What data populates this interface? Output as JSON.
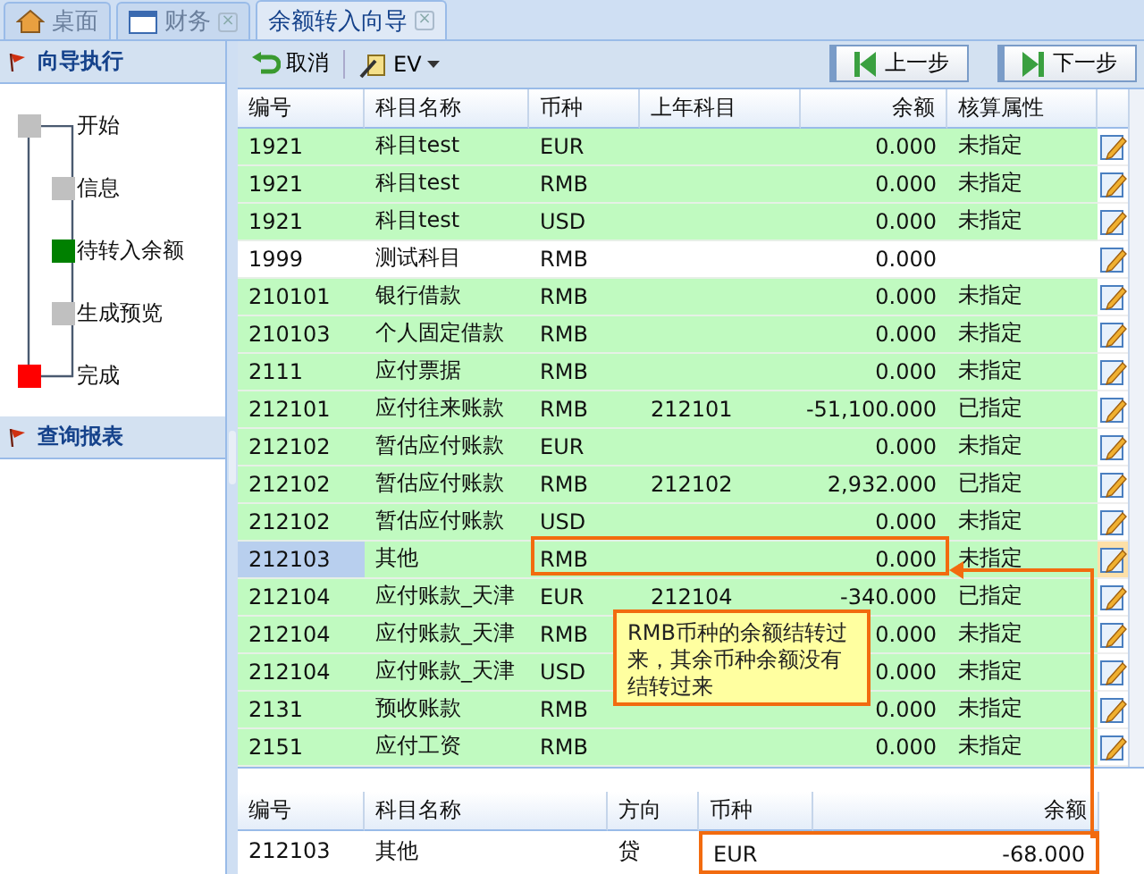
{
  "tabs": [
    {
      "label": "桌面",
      "selected": false
    },
    {
      "label": "财务",
      "close": "×",
      "selected": false
    },
    {
      "label": "余额转入向导",
      "close": "×",
      "selected": true
    }
  ],
  "sidebar": {
    "sections": [
      {
        "title": "向导执行",
        "expanded": true,
        "steps": [
          {
            "label": "开始",
            "kind": "endpoint",
            "color": "#c0c0c0"
          },
          {
            "label": "信息",
            "kind": "step",
            "color": "#c0c0c0"
          },
          {
            "label": "待转入余额",
            "kind": "step",
            "color": "#008000"
          },
          {
            "label": "生成预览",
            "kind": "step",
            "color": "#c0c0c0"
          },
          {
            "label": "完成",
            "kind": "endpoint",
            "color": "#ff0000"
          }
        ]
      },
      {
        "title": "查询报表",
        "expanded": false
      }
    ]
  },
  "toolbar": {
    "buttons": [
      {
        "label": "取消"
      },
      {
        "label": "EV"
      }
    ],
    "nav": [
      {
        "label": "上一步"
      },
      {
        "label": "下一步"
      }
    ]
  },
  "table": {
    "columns": [
      "编号",
      "科目名称",
      "币种",
      "上年科目",
      "余额",
      "核算属性"
    ],
    "rows": [
      {
        "cells": [
          "1921",
          "科目test",
          "EUR",
          "",
          "0.000",
          "未指定"
        ],
        "color": "#c0fac0",
        "selected": false
      },
      {
        "cells": [
          "1921",
          "科目test",
          "RMB",
          "",
          "0.000",
          "未指定"
        ],
        "color": "#c0fac0",
        "selected": false
      },
      {
        "cells": [
          "1921",
          "科目test",
          "USD",
          "",
          "0.000",
          "未指定"
        ],
        "color": "#c0fac0",
        "selected": false
      },
      {
        "cells": [
          "1999",
          "测试科目",
          "RMB",
          "",
          "0.000",
          ""
        ],
        "color": "#ffffff",
        "selected": false
      },
      {
        "cells": [
          "210101",
          "银行借款",
          "RMB",
          "",
          "0.000",
          "未指定"
        ],
        "color": "#c0fac0",
        "selected": false
      },
      {
        "cells": [
          "210103",
          "个人固定借款",
          "RMB",
          "",
          "0.000",
          "未指定"
        ],
        "color": "#c0fac0",
        "selected": false
      },
      {
        "cells": [
          "2111",
          "应付票据",
          "RMB",
          "",
          "0.000",
          "未指定"
        ],
        "color": "#c0fac0",
        "selected": false
      },
      {
        "cells": [
          "212101",
          "应付往来账款",
          "RMB",
          "212101",
          "-51,100.000",
          "已指定"
        ],
        "color": "#c0fac0",
        "selected": false
      },
      {
        "cells": [
          "212102",
          "暂估应付账款",
          "EUR",
          "",
          "0.000",
          "未指定"
        ],
        "color": "#c0fac0",
        "selected": false
      },
      {
        "cells": [
          "212102",
          "暂估应付账款",
          "RMB",
          "212102",
          "2,932.000",
          "已指定"
        ],
        "color": "#c0fac0",
        "selected": false
      },
      {
        "cells": [
          "212102",
          "暂估应付账款",
          "USD",
          "",
          "0.000",
          "未指定"
        ],
        "color": "#c0fac0",
        "selected": false
      },
      {
        "cells": [
          "212103",
          "其他",
          "RMB",
          "",
          "0.000",
          "未指定"
        ],
        "color": "#c0fac0",
        "selected": true
      },
      {
        "cells": [
          "212104",
          "应付账款_天津",
          "EUR",
          "212104",
          "-340.000",
          "已指定"
        ],
        "color": "#c0fac0",
        "selected": false
      },
      {
        "cells": [
          "212104",
          "应付账款_天津",
          "RMB",
          "",
          "0.000",
          "未指定"
        ],
        "color": "#c0fac0",
        "selected": false
      },
      {
        "cells": [
          "212104",
          "应付账款_天津",
          "USD",
          "",
          "0.000",
          "未指定"
        ],
        "color": "#c0fac0",
        "selected": false
      },
      {
        "cells": [
          "2131",
          "预收账款",
          "RMB",
          "",
          "0.000",
          "未指定"
        ],
        "color": "#c0fac0",
        "selected": false
      },
      {
        "cells": [
          "2151",
          "应付工资",
          "RMB",
          "",
          "0.000",
          "未指定"
        ],
        "color": "#c0fac0",
        "selected": false
      }
    ]
  },
  "detail_table": {
    "columns": [
      "编号",
      "科目名称",
      "方向",
      "币种",
      "余额"
    ],
    "rows": [
      {
        "cells": [
          "212103",
          "其他",
          "贷",
          "EUR",
          "-68.000"
        ]
      }
    ]
  },
  "annotation": {
    "text": "RMB币种的余额结转过来，其余币种余额没有结转过来"
  }
}
